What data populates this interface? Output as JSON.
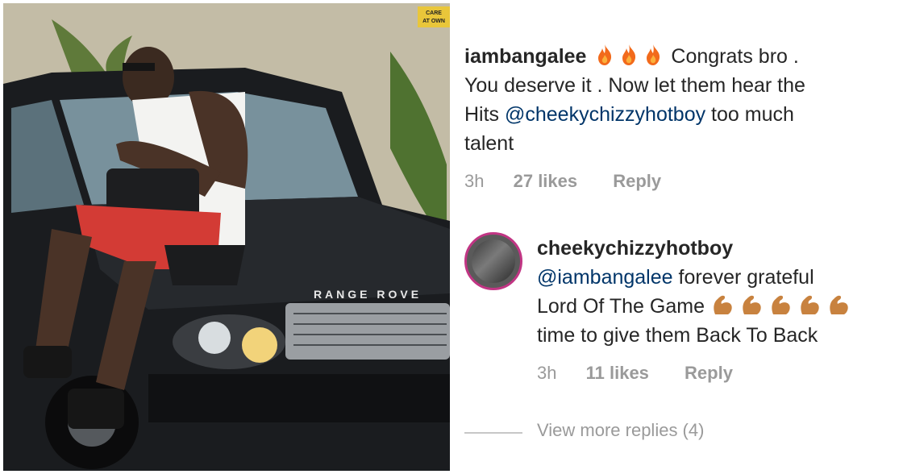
{
  "photo": {
    "sign_text_line1": "CARE",
    "sign_text_line2": "AT OWN",
    "car_brand_text": "RANGE ROVE"
  },
  "comments": [
    {
      "username": "iambangalee",
      "emoji": [
        "fire-icon",
        "fire-icon",
        "fire-icon"
      ],
      "text_line1": "Congrats bro .",
      "text_line2": "You deserve it . Now let them hear the",
      "text_line3_prefix": "Hits ",
      "mention": "@cheekychizzyhotboy",
      "text_line3_suffix": " too much",
      "text_line4": "talent",
      "time": "3h",
      "likes": "27 likes",
      "reply": "Reply"
    },
    {
      "username": "cheekychizzyhotboy",
      "mention": "@iambangalee",
      "text_line1_suffix": " forever grateful",
      "text_line2": "Lord Of The Game",
      "emoji": [
        "flexed-biceps-icon",
        "flexed-biceps-icon",
        "flexed-biceps-icon",
        "flexed-biceps-icon",
        "flexed-biceps-icon"
      ],
      "text_line3": "time to give them Back To Back",
      "time": "3h",
      "likes": "11 likes",
      "reply": "Reply"
    }
  ],
  "view_more_replies": "View more replies (4)",
  "colors": {
    "text": "#262626",
    "meta": "#9a9a9a",
    "mention": "#003569",
    "fire": "#f26a1b",
    "muscle": "#c8823f"
  }
}
